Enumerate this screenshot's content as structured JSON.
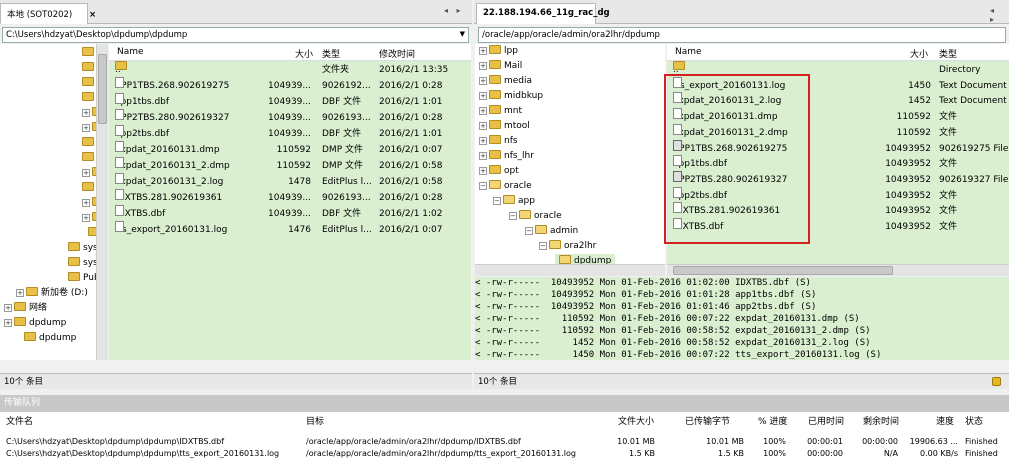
{
  "left": {
    "tab_title": "本地 (SOT0202)",
    "tab_close": "×",
    "nav": "◂ ▸",
    "path": "C:\\Users\\hdzyat\\Desktop\\dpdump\\dpdump",
    "tree": [
      {
        "label": "C"
      },
      {
        "label": "S"
      },
      {
        "label": "C"
      },
      {
        "label": "L"
      },
      {
        "label": "F"
      },
      {
        "label": "S"
      },
      {
        "label": "V"
      },
      {
        "label": "P"
      },
      {
        "label": "D"
      },
      {
        "label": "N"
      },
      {
        "label": "D"
      },
      {
        "label": "D"
      },
      {
        "label": ""
      },
      {
        "label": "sys-"
      },
      {
        "label": "sys-"
      },
      {
        "label": "Publ"
      },
      {
        "label": "新加卷 (D:)"
      },
      {
        "label": "网络"
      },
      {
        "label": "dpdump"
      },
      {
        "label": "dpdump"
      }
    ],
    "columns": {
      "name": "Name",
      "size": "大小",
      "type": "类型",
      "modified": "修改时间"
    },
    "files": [
      {
        "name": "..",
        "size": "",
        "type": "文件夹",
        "modified": "2016/2/1 13:35",
        "kind": "folder"
      },
      {
        "name": "APP1TBS.268.902619275",
        "size": "104939...",
        "type": "9026192...",
        "modified": "2016/2/1 0:28",
        "kind": "file"
      },
      {
        "name": "app1tbs.dbf",
        "size": "104939...",
        "type": "DBF 文件",
        "modified": "2016/2/1 1:01",
        "kind": "file"
      },
      {
        "name": "APP2TBS.280.902619327",
        "size": "104939...",
        "type": "9026193...",
        "modified": "2016/2/1 0:28",
        "kind": "file"
      },
      {
        "name": "app2tbs.dbf",
        "size": "104939...",
        "type": "DBF 文件",
        "modified": "2016/2/1 1:01",
        "kind": "file"
      },
      {
        "name": "expdat_20160131.dmp",
        "size": "110592",
        "type": "DMP 文件",
        "modified": "2016/2/1 0:07",
        "kind": "file"
      },
      {
        "name": "expdat_20160131_2.dmp",
        "size": "110592",
        "type": "DMP 文件",
        "modified": "2016/2/1 0:58",
        "kind": "file"
      },
      {
        "name": "expdat_20160131_2.log",
        "size": "1478",
        "type": "EditPlus l...",
        "modified": "2016/2/1 0:58",
        "kind": "file"
      },
      {
        "name": "IDXTBS.281.902619361",
        "size": "104939...",
        "type": "9026193...",
        "modified": "2016/2/1 0:28",
        "kind": "file"
      },
      {
        "name": "IDXTBS.dbf",
        "size": "104939...",
        "type": "DBF 文件",
        "modified": "2016/2/1 1:02",
        "kind": "file"
      },
      {
        "name": "tts_export_20160131.log",
        "size": "1476",
        "type": "EditPlus l...",
        "modified": "2016/2/1 0:07",
        "kind": "file"
      }
    ],
    "status": "10个 条目"
  },
  "right": {
    "tab_title": "22.188.194.66_11g_rac_dg",
    "nav": "◂ ▸",
    "path": "/oracle/app/oracle/admin/ora2lhr/dpdump",
    "tree": [
      {
        "label": "lpp"
      },
      {
        "label": "Mail"
      },
      {
        "label": "media"
      },
      {
        "label": "midbkup"
      },
      {
        "label": "mnt"
      },
      {
        "label": "mtool"
      },
      {
        "label": "nfs"
      },
      {
        "label": "nfs_lhr"
      },
      {
        "label": "opt"
      },
      {
        "label": "oracle"
      },
      {
        "label": "app"
      },
      {
        "label": "oracle"
      },
      {
        "label": "admin"
      },
      {
        "label": "ora2lhr"
      },
      {
        "label": "dpdump"
      }
    ],
    "columns": {
      "name": "Name",
      "size": "大小",
      "type": "类型"
    },
    "files": [
      {
        "name": "..",
        "size": "",
        "type": "Directory",
        "kind": "folder"
      },
      {
        "name": "tts_export_20160131.log",
        "size": "1450",
        "type": "Text Document",
        "kind": "file"
      },
      {
        "name": "expdat_20160131_2.log",
        "size": "1452",
        "type": "Text Document",
        "kind": "file"
      },
      {
        "name": "expdat_20160131.dmp",
        "size": "110592",
        "type": "文件",
        "kind": "file"
      },
      {
        "name": "expdat_20160131_2.dmp",
        "size": "110592",
        "type": "文件",
        "kind": "file"
      },
      {
        "name": "APP1TBS.268.902619275",
        "size": "10493952",
        "type": "902619275 File",
        "kind": "bin"
      },
      {
        "name": "app1tbs.dbf",
        "size": "10493952",
        "type": "文件",
        "kind": "file"
      },
      {
        "name": "APP2TBS.280.902619327",
        "size": "10493952",
        "type": "902619327 File",
        "kind": "bin"
      },
      {
        "name": "app2tbs.dbf",
        "size": "10493952",
        "type": "文件",
        "kind": "file"
      },
      {
        "name": "IDXTBS.281.902619361",
        "size": "10493952",
        "type": "文件",
        "kind": "file"
      },
      {
        "name": "IDXTBS.dbf",
        "size": "10493952",
        "type": "文件",
        "kind": "file"
      }
    ],
    "log": [
      "< -rw-r-----  10493952 Mon 01-Feb-2016 01:02:00 IDXTBS.dbf (S)",
      "< -rw-r-----  10493952 Mon 01-Feb-2016 01:01:28 app1tbs.dbf (S)",
      "< -rw-r-----  10493952 Mon 01-Feb-2016 01:01:46 app2tbs.dbf (S)",
      "< -rw-r-----    110592 Mon 01-Feb-2016 00:07:22 expdat_20160131.dmp (S)",
      "< -rw-r-----    110592 Mon 01-Feb-2016 00:58:52 expdat_20160131_2.dmp (S)",
      "< -rw-r-----      1452 Mon 01-Feb-2016 00:58:52 expdat_20160131_2.log (S)",
      "< -rw-r-----      1450 Mon 01-Feb-2016 00:07:22 tts_export_20160131.log (S)"
    ],
    "status": "10个 条目"
  },
  "queue": {
    "title": "传输队列",
    "columns": {
      "file": "文件名",
      "target": "目标",
      "size": "文件大小",
      "transferred": "已传输字节",
      "progress": "% 进度",
      "elapsed": "已用时间",
      "remaining": "剩余时间",
      "speed": "速度",
      "state": "状态"
    },
    "rows": [
      {
        "file": "C:\\Users\\hdzyat\\Desktop\\dpdump\\dpdump\\IDXTBS.dbf",
        "target": "/oracle/app/oracle/admin/ora2lhr/dpdump/IDXTBS.dbf",
        "size": "10.01 MB",
        "transferred": "10.01 MB",
        "progress": "100%",
        "elapsed": "00:00:01",
        "remaining": "00:00:00",
        "speed": "19906.63 ...",
        "state": "Finished"
      },
      {
        "file": "C:\\Users\\hdzyat\\Desktop\\dpdump\\dpdump\\tts_export_20160131.log",
        "target": "/oracle/app/oracle/admin/ora2lhr/dpdump/tts_export_20160131.log",
        "size": "1.5 KB",
        "transferred": "1.5 KB",
        "progress": "100%",
        "elapsed": "00:00:00",
        "remaining": "N/A",
        "speed": "0.00 KB/s",
        "state": "Finished"
      }
    ]
  },
  "colors": {
    "selection_green": "#d9efd0",
    "highlight_red": "#d32020"
  }
}
